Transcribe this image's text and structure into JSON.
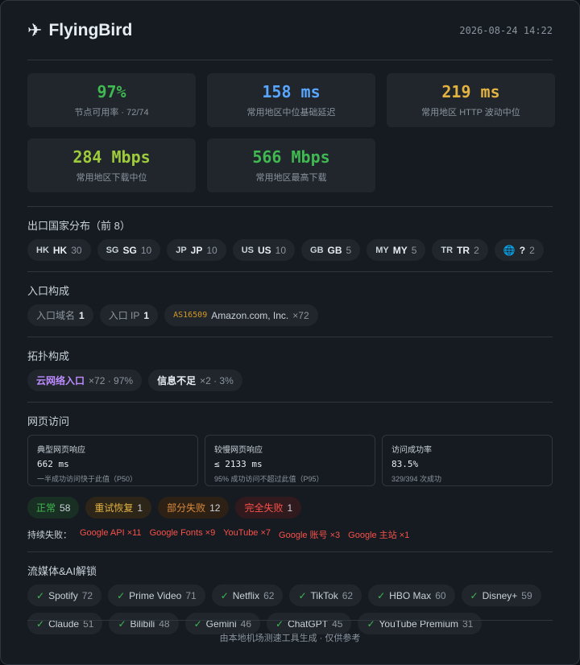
{
  "header": {
    "brand_icon": "airplane-icon",
    "brand_glyph": "✈",
    "title": "FlyingBird",
    "timestamp": "2026-08-24 14:22"
  },
  "stats": [
    {
      "value": "97%",
      "label": "节点可用率 · 72/74",
      "color": "#3fb950"
    },
    {
      "value": "158 ms",
      "label": "常用地区中位基础延迟",
      "color": "#58a6ff"
    },
    {
      "value": "219 ms",
      "label": "常用地区 HTTP 波动中位",
      "color": "#e3b341"
    },
    {
      "value": "284 Mbps",
      "label": "常用地区下载中位",
      "color": "#9ecb3b"
    },
    {
      "value": "566 Mbps",
      "label": "常用地区最高下载",
      "color": "#3fb950"
    }
  ],
  "countries": {
    "title": "出口国家分布（前 8）",
    "items": [
      {
        "code": "HK",
        "name": "HK",
        "count": "30"
      },
      {
        "code": "SG",
        "name": "SG",
        "count": "10"
      },
      {
        "code": "JP",
        "name": "JP",
        "count": "10"
      },
      {
        "code": "US",
        "name": "US",
        "count": "10"
      },
      {
        "code": "GB",
        "name": "GB",
        "count": "5"
      },
      {
        "code": "MY",
        "name": "MY",
        "count": "5"
      },
      {
        "code": "TR",
        "name": "TR",
        "count": "2"
      },
      {
        "code": "🌐",
        "name": "?",
        "count": "2"
      }
    ]
  },
  "entry": {
    "title": "入口构成",
    "domain_label": "入口域名",
    "domain_count": "1",
    "ip_label": "入口 IP",
    "ip_count": "1",
    "asn": "AS16509",
    "org": "Amazon.com, Inc.",
    "asn_count": "×72"
  },
  "topology": {
    "title": "拓扑构成",
    "items": [
      {
        "name": "云网络入口",
        "detail": "×72 · 97%"
      },
      {
        "name": "信息不足",
        "detail": "×2 · 3%"
      }
    ]
  },
  "web": {
    "title": "网页访问",
    "metrics": [
      {
        "title": "典型网页响应",
        "value": "662 ms",
        "sub": "一半成功访问快于此值（P50）"
      },
      {
        "title": "较慢网页响应",
        "value": "≤ 2133 ms",
        "sub": "95% 成功访问不超过此值（P95）"
      },
      {
        "title": "访问成功率",
        "value": "83.5%",
        "sub": "329/394 次成功"
      }
    ],
    "statuses": [
      {
        "label": "正常",
        "count": "58"
      },
      {
        "label": "重试恢复",
        "count": "1"
      },
      {
        "label": "部分失败",
        "count": "12"
      },
      {
        "label": "完全失败",
        "count": "1"
      }
    ],
    "persist_label": "持续失败：",
    "persist_items": [
      "Google API ×11",
      "Google Fonts ×9",
      "YouTube ×7",
      "Google 账号 ×3",
      "Google 主站 ×1"
    ]
  },
  "streaming": {
    "title": "流媒体&AI解锁",
    "check_icon": "✓",
    "items": [
      {
        "name": "Spotify",
        "count": "72"
      },
      {
        "name": "Prime Video",
        "count": "71"
      },
      {
        "name": "Netflix",
        "count": "62"
      },
      {
        "name": "TikTok",
        "count": "62"
      },
      {
        "name": "HBO Max",
        "count": "60"
      },
      {
        "name": "Disney+",
        "count": "59"
      },
      {
        "name": "Claude",
        "count": "51"
      },
      {
        "name": "Bilibili",
        "count": "48"
      },
      {
        "name": "Gemini",
        "count": "46"
      },
      {
        "name": "ChatGPT",
        "count": "45"
      },
      {
        "name": "YouTube Premium",
        "count": "31"
      }
    ]
  },
  "footer": {
    "text": "由本地机场测速工具生成 · 仅供参考"
  }
}
